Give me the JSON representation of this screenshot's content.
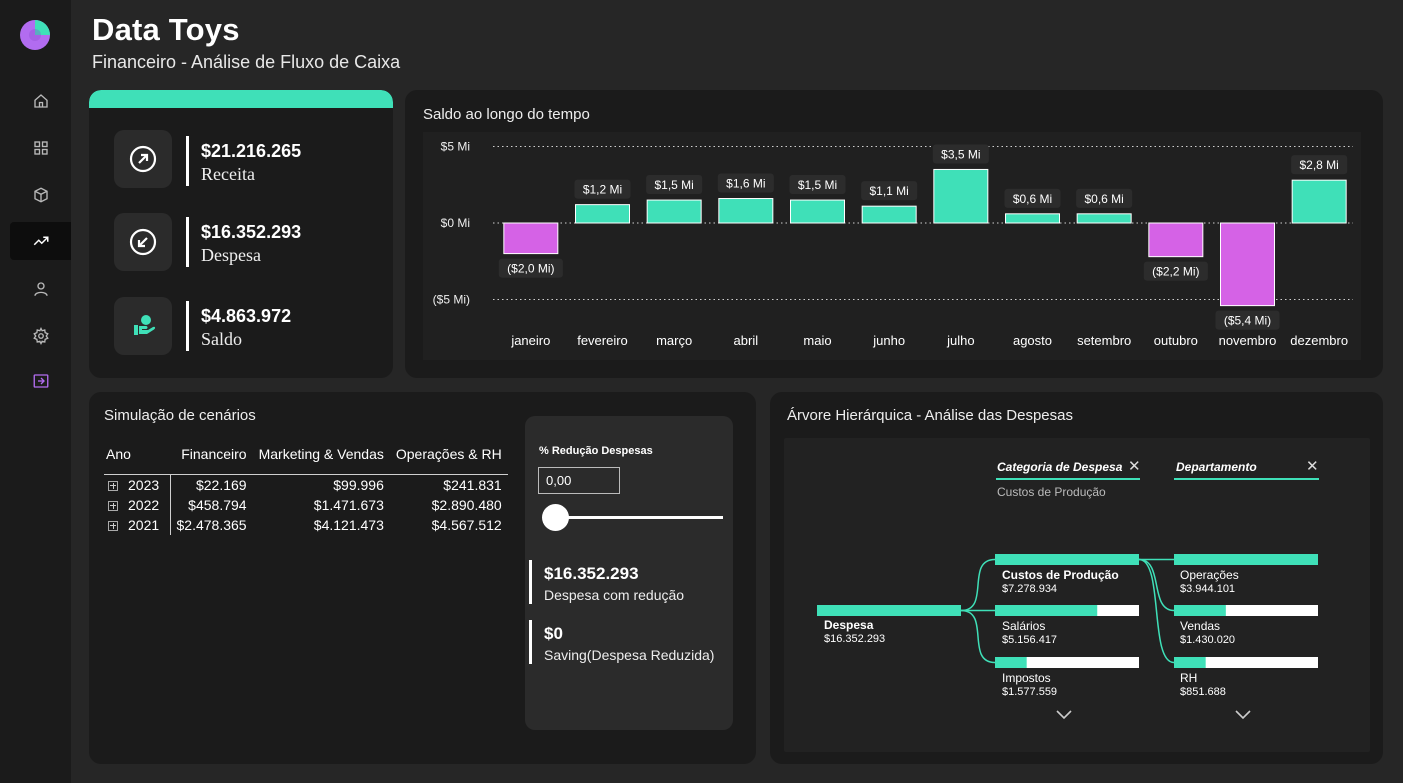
{
  "app": {
    "title": "Data Toys",
    "subtitle": "Financeiro - Análise de Fluxo de Caixa"
  },
  "colors": {
    "accent": "#3fe0b8",
    "negative": "#d562e6",
    "card": "#1b1b1b",
    "background": "#262626"
  },
  "sidebar": {
    "items": [
      {
        "icon": "home-icon"
      },
      {
        "icon": "grid-icon"
      },
      {
        "icon": "box-icon"
      },
      {
        "icon": "trend-icon",
        "active": true
      },
      {
        "icon": "user-icon"
      },
      {
        "icon": "gear-icon"
      },
      {
        "icon": "exit-icon"
      }
    ]
  },
  "kpis": [
    {
      "value": "$21.216.265",
      "label": "Receita",
      "icon": "arrow-up-right-icon"
    },
    {
      "value": "$16.352.293",
      "label": "Despesa",
      "icon": "arrow-down-left-icon"
    },
    {
      "value": "$4.863.972",
      "label": "Saldo",
      "icon": "hand-money-icon"
    }
  ],
  "chart_data": {
    "type": "bar",
    "title": "Saldo ao longo do tempo",
    "categories": [
      "janeiro",
      "fevereiro",
      "março",
      "abril",
      "maio",
      "junho",
      "julho",
      "agosto",
      "setembro",
      "outubro",
      "novembro",
      "dezembro"
    ],
    "values": [
      -2.0,
      1.2,
      1.5,
      1.6,
      1.5,
      1.1,
      3.5,
      0.6,
      0.6,
      -2.2,
      -5.4,
      2.8
    ],
    "data_labels": [
      "($2,0 Mi)",
      "$1,2 Mi",
      "$1,5 Mi",
      "$1,6 Mi",
      "$1,5 Mi",
      "$1,1 Mi",
      "$3,5 Mi",
      "$0,6 Mi",
      "$0,6 Mi",
      "($2,2 Mi)",
      "($5,4 Mi)",
      "$2,8 Mi"
    ],
    "y_ticks": [
      5,
      0,
      -5
    ],
    "y_tick_labels": [
      "$5 Mi",
      "$0 Mi",
      "($5 Mi)"
    ],
    "ylim": [
      -5.4,
      5
    ],
    "grid": true
  },
  "simulation": {
    "title": "Simulação de cenários",
    "columns": [
      "Ano",
      "Financeiro",
      "Marketing & Vendas",
      "Operações & RH"
    ],
    "rows": [
      [
        "2023",
        "$22.169",
        "$99.996",
        "$241.831"
      ],
      [
        "2022",
        "$458.794",
        "$1.471.673",
        "$2.890.480"
      ],
      [
        "2021",
        "$2.478.365",
        "$4.121.473",
        "$4.567.512"
      ]
    ],
    "slicer": {
      "label": "% Redução Despesas",
      "value": "0,00",
      "slider_fraction": 0
    },
    "results": [
      {
        "value": "$16.352.293",
        "label": "Despesa com redução"
      },
      {
        "value": "$0",
        "label": "Saving(Despesa Reduzida)"
      }
    ]
  },
  "tree": {
    "title": "Árvore Hierárquica - Análise das Despesas",
    "level1_header": "Categoria de Despesa",
    "level1_selected": "Custos de Produção",
    "level2_header": "Departamento",
    "root": {
      "name": "Despesa",
      "value": "$16.352.293",
      "fraction": 1.0
    },
    "level1": [
      {
        "name": "Custos de Produção",
        "value": "$7.278.934",
        "fraction": 1.0,
        "selected": true
      },
      {
        "name": "Salários",
        "value": "$5.156.417",
        "fraction": 0.71
      },
      {
        "name": "Impostos",
        "value": "$1.577.559",
        "fraction": 0.22
      }
    ],
    "level2": [
      {
        "name": "Operações",
        "value": "$3.944.101",
        "fraction": 1.0
      },
      {
        "name": "Vendas",
        "value": "$1.430.020",
        "fraction": 0.36
      },
      {
        "name": "RH",
        "value": "$851.688",
        "fraction": 0.22
      }
    ]
  }
}
